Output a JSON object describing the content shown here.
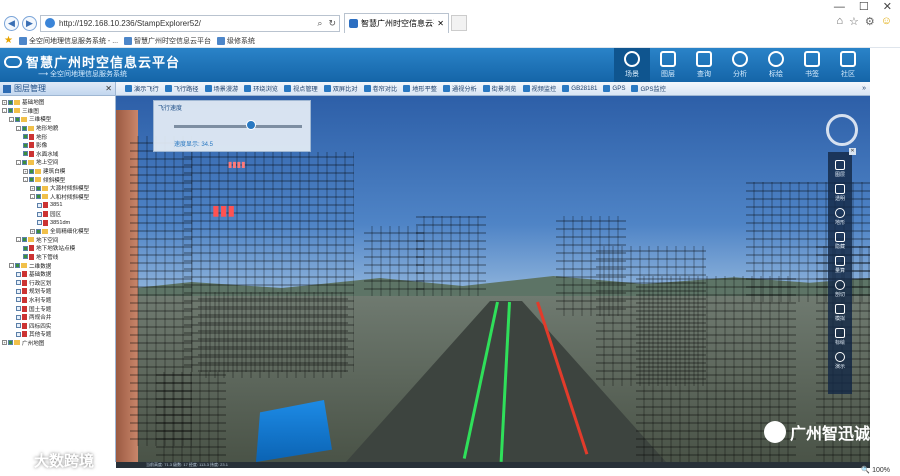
{
  "browser": {
    "window_controls": [
      "—",
      "☐",
      "✕"
    ],
    "address": "http://192.168.10.236/StampExplorer52/",
    "tab_title": "智慧广州时空信息云平台",
    "right_tools": [
      "⌂",
      "☆",
      "⚙",
      "☺"
    ],
    "favorites": [
      "全空间地理信息服务系统 - ...",
      "智慧广州时空信息云平台",
      "级修系统"
    ]
  },
  "app": {
    "title": "智慧广州时空信息云平台",
    "subtitle": "全空间地理信息服务系统",
    "topnav": [
      "场景",
      "图层",
      "查询",
      "分析",
      "标绘",
      "书签",
      "社区"
    ]
  },
  "left_panel": {
    "header": "图层管理",
    "close": "✕",
    "tree": [
      {
        "label": "基础地图",
        "indent": 0,
        "toggle": "+",
        "checked": true
      },
      {
        "label": "三维图",
        "indent": 0,
        "toggle": "-",
        "checked": true
      },
      {
        "label": "三维模型",
        "indent": 1,
        "toggle": "-",
        "checked": true
      },
      {
        "label": "地形地貌",
        "indent": 2,
        "toggle": "-",
        "checked": true
      },
      {
        "label": "地形",
        "indent": 3,
        "checked": true
      },
      {
        "label": "影像",
        "indent": 3,
        "checked": true
      },
      {
        "label": "水面水域",
        "indent": 3,
        "checked": true
      },
      {
        "label": "地上空间",
        "indent": 2,
        "toggle": "-",
        "checked": true
      },
      {
        "label": "建筑白模",
        "indent": 3,
        "toggle": "+",
        "checked": true
      },
      {
        "label": "倾斜模型",
        "indent": 3,
        "toggle": "-",
        "checked": true
      },
      {
        "label": "大源村倾斜模型",
        "indent": 4,
        "toggle": "+",
        "checked": true
      },
      {
        "label": "人和村倾斜模型",
        "indent": 4,
        "toggle": "-",
        "checked": true
      },
      {
        "label": "3851",
        "indent": 5,
        "checked": false
      },
      {
        "label": "园区",
        "indent": 5,
        "checked": false
      },
      {
        "label": "3851dm",
        "indent": 5,
        "checked": false
      },
      {
        "label": "全局精细化模型",
        "indent": 4,
        "toggle": "+",
        "checked": true
      },
      {
        "label": "地下空间",
        "indent": 2,
        "toggle": "-",
        "checked": true
      },
      {
        "label": "地下地铁站点模",
        "indent": 3,
        "checked": true
      },
      {
        "label": "地下管线",
        "indent": 3,
        "checked": true
      },
      {
        "label": "二维数据",
        "indent": 1,
        "toggle": "-",
        "checked": true
      },
      {
        "label": "基础数据",
        "indent": 2,
        "checked": false
      },
      {
        "label": "行政区划",
        "indent": 2,
        "checked": false
      },
      {
        "label": "规划专题",
        "indent": 2,
        "checked": false
      },
      {
        "label": "水利专题",
        "indent": 2,
        "checked": false
      },
      {
        "label": "国土专题",
        "indent": 2,
        "checked": false
      },
      {
        "label": "两规合并",
        "indent": 2,
        "checked": false
      },
      {
        "label": "四标四实",
        "indent": 2,
        "checked": false
      },
      {
        "label": "其他专题",
        "indent": 2,
        "checked": false
      },
      {
        "label": "广州地图",
        "indent": 0,
        "toggle": "+",
        "checked": true
      }
    ]
  },
  "map_toolbar": [
    "演示飞行",
    "飞行路径",
    "场景漫游",
    "环绕浏览",
    "视点管理",
    "双屏比对",
    "卷帘对比",
    "地形平整",
    "通视分析",
    "街景浏览",
    "视频监控",
    "GB28181",
    "GPS",
    "GPS监控"
  ],
  "map_toolbar_more": "»",
  "flight_panel": {
    "title": "飞行速度",
    "status": "速度显示: 34.5"
  },
  "flight_speed": 0.6,
  "right_tools": [
    "图层",
    "透明",
    "地形",
    "隐藏",
    "量算",
    "剖切",
    "模拟",
    "标绘",
    "演示"
  ],
  "status_text": "当前高度: 71.3  级数: 17  经度: 113.3   纬度: 23.1",
  "zoom": "100%",
  "watermarks": {
    "left": "大数跨境",
    "right": "广州智迅诚"
  },
  "colors": {
    "header": "#1565a8",
    "accent": "#2a79c2"
  }
}
